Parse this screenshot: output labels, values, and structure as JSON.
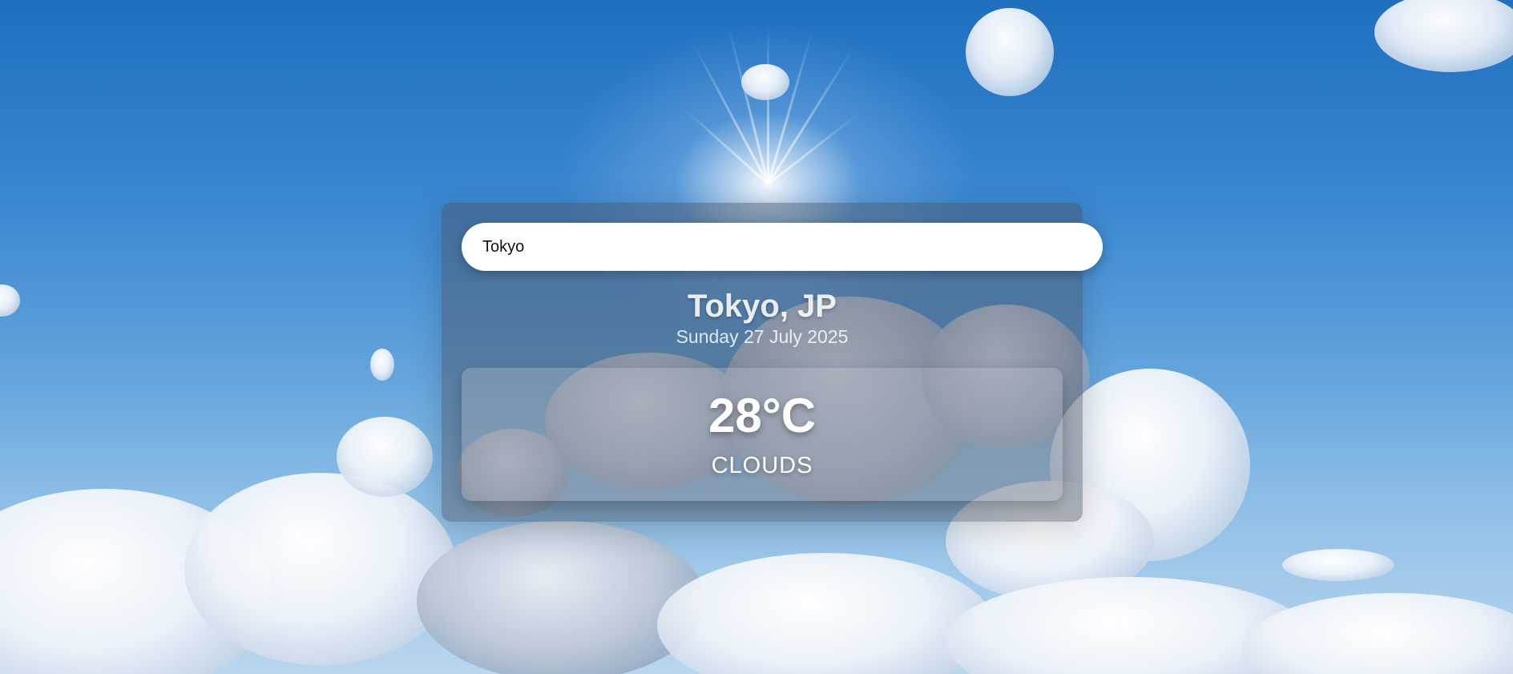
{
  "search": {
    "value": "Tokyo",
    "placeholder": ""
  },
  "weather": {
    "location": "Tokyo, JP",
    "date": "Sunday 27 July 2025",
    "temperature": "28°C",
    "condition": "CLOUDS"
  },
  "colors": {
    "sky_top": "#1f6fbf",
    "sky_bottom": "#b9d6ef",
    "card_overlay": "#46505f",
    "text": "#ffffff"
  }
}
